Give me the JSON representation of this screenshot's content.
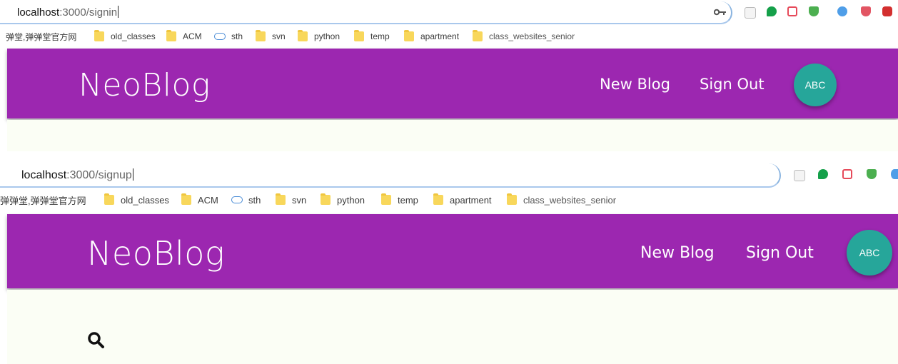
{
  "top_window": {
    "url_host": "localhost",
    "url_path": ":3000/signin",
    "bookmarks": [
      "弹堂,弹弹堂官方网",
      "old_classes",
      "ACM",
      "sth",
      "svn",
      "python",
      "temp",
      "apartment",
      "class_websites_senior"
    ],
    "brand": "NeoBlog",
    "nav_new_blog": "New Blog",
    "nav_sign_out": "Sign Out",
    "avatar": "ABC"
  },
  "bottom_window": {
    "url_host": "localhost",
    "url_path": ":3000/signup",
    "bookmarks": [
      "弹弹堂,弹弹堂官方网",
      "old_classes",
      "ACM",
      "sth",
      "svn",
      "python",
      "temp",
      "apartment",
      "class_websites_senior"
    ],
    "brand": "NeoBlog",
    "nav_new_blog": "New Blog",
    "nav_sign_out": "Sign Out",
    "avatar": "ABC"
  },
  "icons": {
    "search": "search-icon",
    "key": "key-icon",
    "pdf": "pdf-extension-icon",
    "evernote": "evernote-extension-icon",
    "pocket": "pocket-extension-icon",
    "adguard": "adguard-extension-icon"
  },
  "colors": {
    "header": "#9c27b0",
    "avatar": "#26a69a",
    "content_bg": "#fbfef5"
  }
}
